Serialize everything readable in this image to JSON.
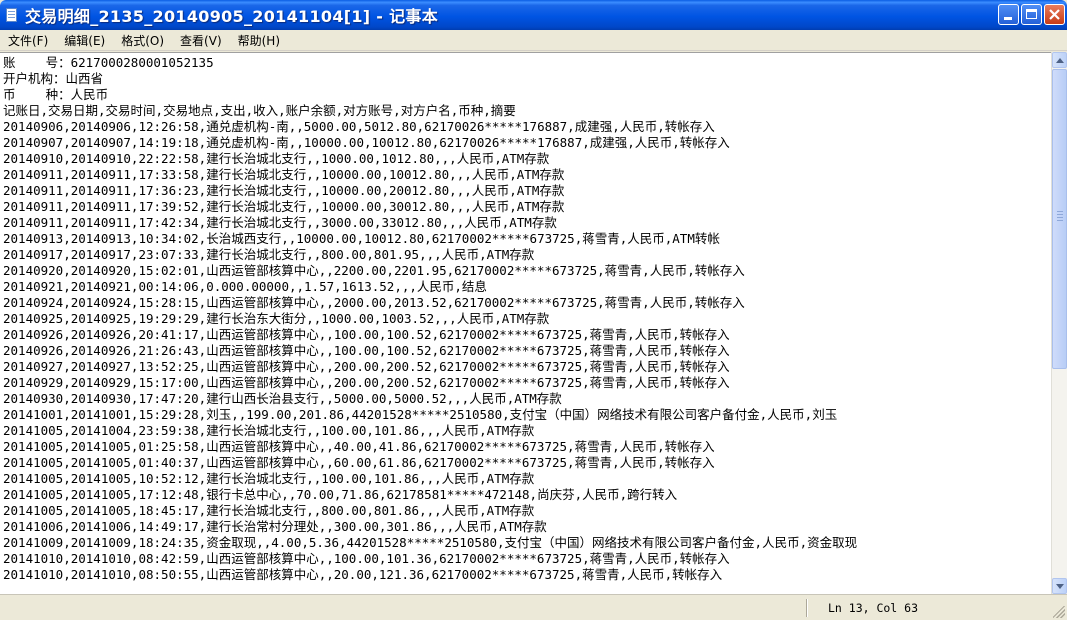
{
  "window": {
    "title": "交易明细_2135_20140905_20141104[1] - 记事本"
  },
  "menu": {
    "items": [
      "文件(F)",
      "编辑(E)",
      "格式(O)",
      "查看(V)",
      "帮助(H)"
    ]
  },
  "document": {
    "lines": [
      "账    号：6217000280001052135",
      "开户机构：山西省",
      "币    种：人民币",
      "记账日,交易日期,交易时间,交易地点,支出,收入,账户余额,对方账号,对方户名,币种,摘要",
      "20140906,20140906,12:26:58,通兑虚机构-南,,5000.00,5012.80,62170026*****176887,成建强,人民币,转帐存入",
      "20140907,20140907,14:19:18,通兑虚机构-南,,10000.00,10012.80,62170026*****176887,成建强,人民币,转帐存入",
      "20140910,20140910,22:22:58,建行长治城北支行,,1000.00,1012.80,,,人民币,ATM存款",
      "20140911,20140911,17:33:58,建行长治城北支行,,10000.00,10012.80,,,人民币,ATM存款",
      "20140911,20140911,17:36:23,建行长治城北支行,,10000.00,20012.80,,,人民币,ATM存款",
      "20140911,20140911,17:39:52,建行长治城北支行,,10000.00,30012.80,,,人民币,ATM存款",
      "20140911,20140911,17:42:34,建行长治城北支行,,3000.00,33012.80,,,人民币,ATM存款",
      "20140913,20140913,10:34:02,长治城西支行,,10000.00,10012.80,62170002*****673725,蒋雪青,人民币,ATM转帐",
      "20140917,20140917,23:07:33,建行长治城北支行,,800.00,801.95,,,人民币,ATM存款",
      "20140920,20140920,15:02:01,山西运管部核算中心,,2200.00,2201.95,62170002*****673725,蒋雪青,人民币,转帐存入",
      "20140921,20140921,00:14:06,0.000.00000,,1.57,1613.52,,,人民币,结息",
      "20140924,20140924,15:28:15,山西运管部核算中心,,2000.00,2013.52,62170002*****673725,蒋雪青,人民币,转帐存入",
      "20140925,20140925,19:29:29,建行长治东大街分,,1000.00,1003.52,,,人民币,ATM存款",
      "20140926,20140926,20:41:17,山西运管部核算中心,,100.00,100.52,62170002*****673725,蒋雪青,人民币,转帐存入",
      "20140926,20140926,21:26:43,山西运管部核算中心,,100.00,100.52,62170002*****673725,蒋雪青,人民币,转帐存入",
      "20140927,20140927,13:52:25,山西运管部核算中心,,200.00,200.52,62170002*****673725,蒋雪青,人民币,转帐存入",
      "20140929,20140929,15:17:00,山西运管部核算中心,,200.00,200.52,62170002*****673725,蒋雪青,人民币,转帐存入",
      "20140930,20140930,17:47:20,建行山西长治县支行,,5000.00,5000.52,,,人民币,ATM存款",
      "20141001,20141001,15:29:28,刘玉,,199.00,201.86,44201528*****2510580,支付宝（中国）网络技术有限公司客户备付金,人民币,刘玉",
      "20141005,20141004,23:59:38,建行长治城北支行,,100.00,101.86,,,人民币,ATM存款",
      "20141005,20141005,01:25:58,山西运管部核算中心,,40.00,41.86,62170002*****673725,蒋雪青,人民币,转帐存入",
      "20141005,20141005,01:40:37,山西运管部核算中心,,60.00,61.86,62170002*****673725,蒋雪青,人民币,转帐存入",
      "20141005,20141005,10:52:12,建行长治城北支行,,100.00,101.86,,,人民币,ATM存款",
      "20141005,20141005,17:12:48,银行卡总中心,,70.00,71.86,62178581*****472148,尚庆芬,人民币,跨行转入",
      "20141005,20141005,18:45:17,建行长治城北支行,,800.00,801.86,,,人民币,ATM存款",
      "20141006,20141006,14:49:17,建行长治常村分理处,,300.00,301.86,,,人民币,ATM存款",
      "20141009,20141009,18:24:35,资金取现,,4.00,5.36,44201528*****2510580,支付宝（中国）网络技术有限公司客户备付金,人民币,资金取现",
      "20141010,20141010,08:42:59,山西运管部核算中心,,100.00,101.36,62170002*****673725,蒋雪青,人民币,转帐存入",
      "20141010,20141010,08:50:55,山西运管部核算中心,,20.00,121.36,62170002*****673725,蒋雪青,人民币,转帐存入"
    ]
  },
  "status": {
    "cursor": "Ln 13, Col 63"
  }
}
